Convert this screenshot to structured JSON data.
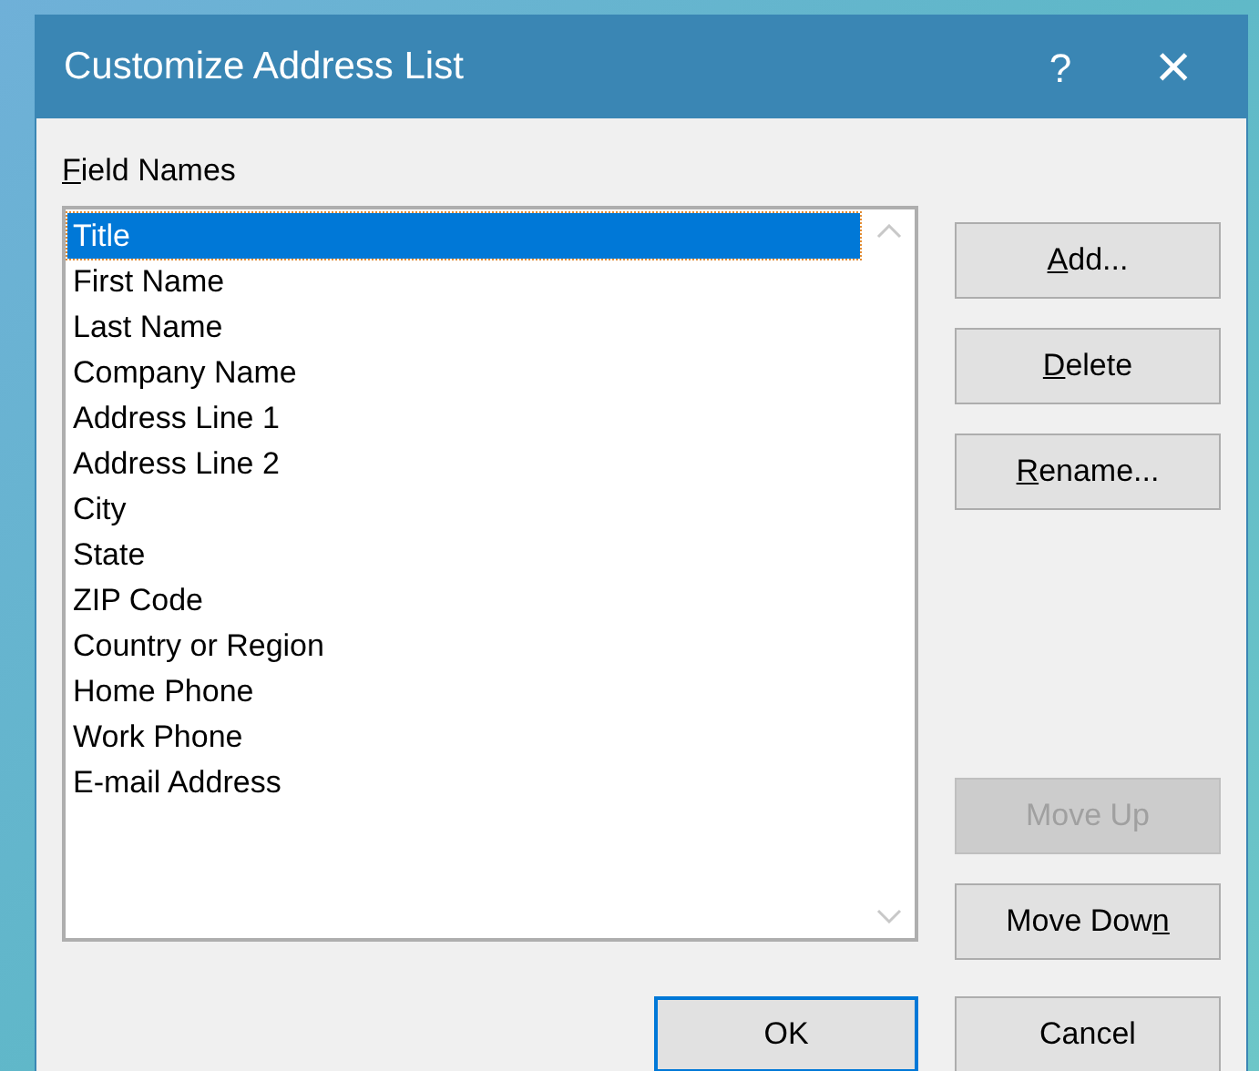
{
  "window": {
    "title": "Customize Address List",
    "help": "?",
    "close": "×"
  },
  "field_names": {
    "label_parts": [
      {
        "text": "F",
        "underline": true
      },
      {
        "text": "ield Names",
        "underline": false
      }
    ],
    "items": [
      {
        "label": "Title",
        "selected": true
      },
      {
        "label": "First Name",
        "selected": false
      },
      {
        "label": "Last Name",
        "selected": false
      },
      {
        "label": "Company Name",
        "selected": false
      },
      {
        "label": "Address Line 1",
        "selected": false
      },
      {
        "label": "Address Line 2",
        "selected": false
      },
      {
        "label": "City",
        "selected": false
      },
      {
        "label": "State",
        "selected": false
      },
      {
        "label": "ZIP Code",
        "selected": false
      },
      {
        "label": "Country or Region",
        "selected": false
      },
      {
        "label": "Home Phone",
        "selected": false
      },
      {
        "label": "Work Phone",
        "selected": false
      },
      {
        "label": "E-mail Address",
        "selected": false
      }
    ]
  },
  "side_buttons": [
    {
      "label_parts": [
        {
          "text": "A",
          "underline": true
        },
        {
          "text": "dd...",
          "underline": false
        }
      ],
      "disabled": false
    },
    {
      "label_parts": [
        {
          "text": "D",
          "underline": true
        },
        {
          "text": "elete",
          "underline": false
        }
      ],
      "disabled": false
    },
    {
      "label_parts": [
        {
          "text": "R",
          "underline": true
        },
        {
          "text": "ename...",
          "underline": false
        }
      ],
      "disabled": false
    },
    {
      "label_parts": [
        {
          "text": "Move Up",
          "underline": false
        }
      ],
      "disabled": true
    },
    {
      "label_parts": [
        {
          "text": "Move Dow",
          "underline": false
        },
        {
          "text": "n",
          "underline": true
        }
      ],
      "disabled": false
    }
  ],
  "footer_buttons": [
    {
      "label": "OK",
      "default": true
    },
    {
      "label": "Cancel",
      "default": false
    }
  ]
}
